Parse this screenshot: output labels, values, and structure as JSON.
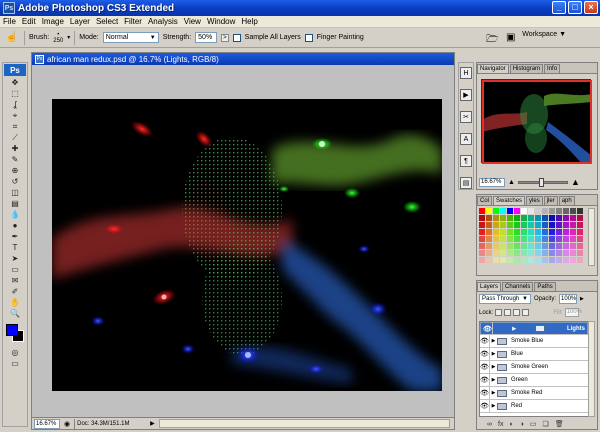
{
  "window": {
    "title": "Adobe Photoshop CS3 Extended",
    "app_icon": "Ps",
    "buttons": [
      "_",
      "□",
      "×"
    ]
  },
  "menu": [
    "File",
    "Edit",
    "Image",
    "Layer",
    "Select",
    "Filter",
    "Analysis",
    "View",
    "Window",
    "Help"
  ],
  "options": {
    "brush_label": "Brush:",
    "brush_size": "250",
    "mode_label": "Mode:",
    "mode_value": "Normal",
    "strength_label": "Strength:",
    "strength_value": "50%",
    "sample_all_label": "Sample All Layers",
    "finger_label": "Finger Painting",
    "workspace_label": "Workspace ▼"
  },
  "tools": {
    "logo": "Ps",
    "icons": [
      "move-tool-icon",
      "marquee-tool-icon",
      "lasso-tool-icon",
      "quick-select-tool-icon",
      "crop-tool-icon",
      "slice-tool-icon",
      "healing-brush-icon",
      "brush-tool-icon",
      "clone-stamp-icon",
      "history-brush-icon",
      "eraser-tool-icon",
      "gradient-tool-icon",
      "blur-tool-icon",
      "dodge-tool-icon",
      "pen-tool-icon",
      "type-tool-icon",
      "path-select-icon",
      "shape-tool-icon",
      "notes-tool-icon",
      "eyedropper-tool-icon",
      "hand-tool-icon",
      "zoom-tool-icon"
    ],
    "glyphs": [
      "✥",
      "⬚",
      "ʆ",
      "⌖",
      "⌗",
      "⟋",
      "✚",
      "✎",
      "⊕",
      "↺",
      "◫",
      "▤",
      "💧",
      "●",
      "✒",
      "T",
      "➤",
      "▭",
      "✉",
      "✐",
      "✋",
      "🔍"
    ],
    "fg_color": "#0000ff",
    "bg_color": "#000000"
  },
  "document": {
    "title": "african man redux.psd @ 16.7% (Lights, RGB/8)",
    "zoom": "16.67%",
    "doc_info": "Doc: 34.3M/151.1M"
  },
  "dock": [
    "H",
    "▶",
    "✂",
    "A",
    "¶",
    "▤"
  ],
  "navigator": {
    "tabs": [
      "Navigator",
      "Histogram",
      "Info"
    ],
    "zoom": "16.67%",
    "slider_level": 0.45
  },
  "swatches": {
    "tabs": [
      "Col",
      "Swatches",
      "yles",
      "jler",
      "aph"
    ]
  },
  "layers": {
    "tabs": [
      "Layers",
      "Channels",
      "Paths"
    ],
    "blend_mode": "Pass Through",
    "opacity_label": "Opacity:",
    "opacity_value": "100%",
    "lock_label": "Lock:",
    "fill_label": "Fill:",
    "fill_value": "100%",
    "items": [
      {
        "name": "Lights",
        "selected": true
      },
      {
        "name": "Smoke Blue",
        "selected": false
      },
      {
        "name": "Blue",
        "selected": false
      },
      {
        "name": "Smoke Green",
        "selected": false
      },
      {
        "name": "Green",
        "selected": false
      },
      {
        "name": "Smoke Red",
        "selected": false
      },
      {
        "name": "Red",
        "selected": false
      }
    ],
    "bottom_icons": [
      "link-layers-icon",
      "fx-icon",
      "mask-icon",
      "adjustment-icon",
      "group-icon",
      "new-layer-icon",
      "trash-icon"
    ],
    "bottom_glyphs": [
      "∞",
      "fx",
      "◐",
      "◑",
      "▭",
      "❏",
      "🗑"
    ]
  }
}
